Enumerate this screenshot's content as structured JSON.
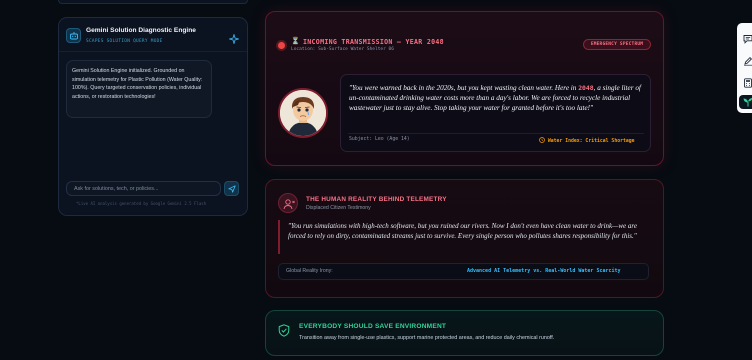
{
  "diagnostic_panel": {
    "title": "Gemini Solution Diagnostic Engine",
    "subtitle": "SCAPES SOLUTION QUERY MODE",
    "message": "Gemini Solution Engine initialized. Grounded on simulation telemetry for Plastic Pollution (Water Quality: 100%). Query targeted conservation policies, individual actions, or restoration technologies!",
    "input_placeholder": "Ask for solutions, tech, or policies...",
    "footnote": "*Live AI analysis generated by Google Gemini 2.5 Flash",
    "icons": {
      "logo": "robot-icon",
      "sparkle": "sparkle-icon",
      "send": "send-icon"
    }
  },
  "transmission_card": {
    "title_icon": "hourglass-icon",
    "title": "INCOMING TRANSMISSION — YEAR 2048",
    "location": "Location: Sub-Surface Water Shelter 06",
    "badge": "EMERGENCY SPECTRUM",
    "quote_before": "\"You were warned back in the 2020s, but you kept wasting clean water. Here in ",
    "quote_highlight": "2048",
    "quote_after": ", a single liter of un-contaminated drinking water costs more than a day's labor. We are forced to recycle industrial wastewater just to stay alive. Stop taking your water for granted before it's too late!\"",
    "subject": "Subject: Leo (Age 14)",
    "water_index": "Water Index: Critical Shortage",
    "colors": {
      "accent": "#fb6f84",
      "warning": "#f59e0b"
    }
  },
  "reality_card": {
    "title": "THE HUMAN REALITY BEHIND TELEMETRY",
    "subtitle": "Displaced Citizen Testimony",
    "testimony": "\"You run simulations with high-tech software, but you ruined our rivers. Now I don't even have clean water to drink—we are forced to rely on dirty, contaminated streams just to survive. Every single person who pollutes shares responsibility for this.\"",
    "irony_label": "Global Reality Irony:",
    "irony_value": "Advanced AI Telemetry vs. Real-World Water Scarcity"
  },
  "environment_card": {
    "title": "EVERYBODY SHOULD SAVE ENVIRONMENT",
    "text": "Transition away from single-use plastics, support marine protected areas, and reduce daily chemical runoff.",
    "color": "#34d399"
  },
  "toolbar": {
    "icons": [
      "chat-icon",
      "pen-icon",
      "calculator-icon",
      "sprout-icon"
    ]
  }
}
